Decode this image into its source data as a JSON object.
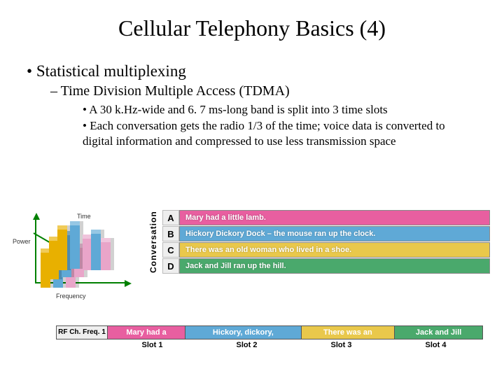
{
  "title": "Cellular Telephony Basics (4)",
  "bullets": {
    "level1": "Statistical multiplexing",
    "level2": "Time Division Multiple Access (TDMA)",
    "level3a": "A 30 k.Hz-wide and 6. 7 ms-long band is split into 3 time slots",
    "level3b": "Each conversation gets the radio 1/3 of the time; voice data is converted to digital information and compressed to use less transmission space"
  },
  "diagram3d": {
    "axis_y": "Power",
    "axis_x": "Frequency",
    "axis_z": "Time"
  },
  "conversation": {
    "side": "Conversation",
    "rows": [
      {
        "letter": "A",
        "text": "Mary had a little lamb.",
        "color": "#e85fa0"
      },
      {
        "letter": "B",
        "text": "Hickory Dickory Dock – the mouse ran up the clock.",
        "color": "#5fa9d6"
      },
      {
        "letter": "C",
        "text": "There was an old woman who lived in a shoe.",
        "color": "#e9c84b"
      },
      {
        "letter": "D",
        "text": "Jack and Jill ran up the hill.",
        "color": "#4aa96c"
      }
    ]
  },
  "slots": {
    "header": "RF Ch.\nFreq. 1",
    "cells": [
      {
        "text": "Mary had a",
        "color": "#e85fa0"
      },
      {
        "text": "Hickory, dickory,",
        "color": "#5fa9d6"
      },
      {
        "text": "There was an",
        "color": "#e9c84b"
      },
      {
        "text": "Jack and Jill",
        "color": "#4aa96c"
      }
    ],
    "labels": [
      "Slot 1",
      "Slot 2",
      "Slot 3",
      "Slot 4"
    ]
  }
}
